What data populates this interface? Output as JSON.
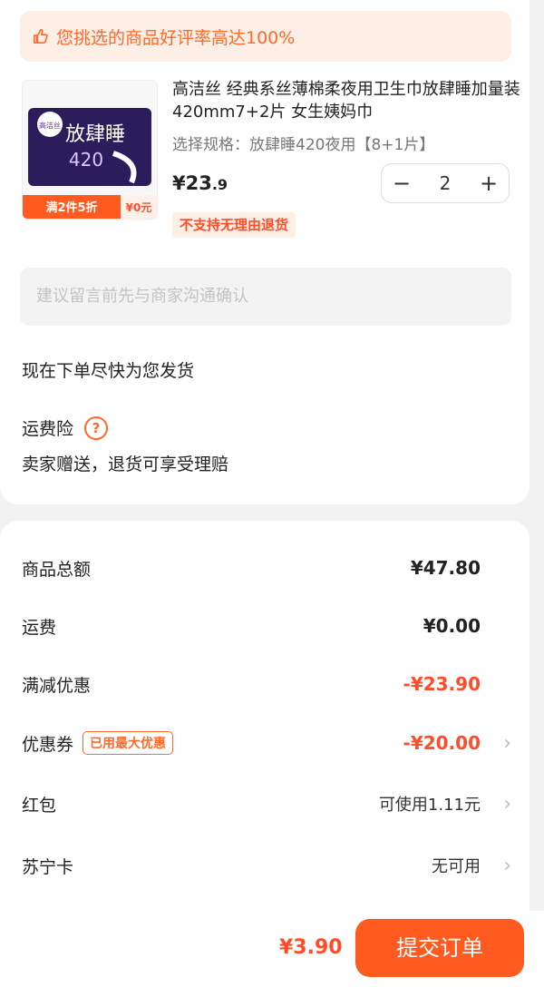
{
  "banner": {
    "text": "您挑选的商品好评率高达100%",
    "icon": "thumbs-up-icon"
  },
  "product": {
    "thumb_brand": "高洁丝",
    "thumb_title": "放肆睡",
    "thumb_size": "420",
    "thumb_promo": "满2件5折",
    "thumb_price": "¥0元",
    "title": "高洁丝 经典系丝薄棉柔夜用卫生巾放肆睡加量装420mm7+2片 女生姨妈巾",
    "spec": "选择规格：放肆睡420夜用【8+1片】",
    "price_main": "¥23",
    "price_dec": ".9",
    "quantity": "2",
    "minus": "−",
    "plus": "+",
    "return_tag": "不支持无理由退货"
  },
  "memo": {
    "placeholder": "建议留言前先与商家沟通确认"
  },
  "shipping_note": "现在下单尽快为您发货",
  "insurance": {
    "label": "运费险",
    "help_icon": "question-circle-icon",
    "desc": "卖家赠送，退货可享受理赔"
  },
  "summary": [
    {
      "label": "商品总额",
      "value": "¥47.80"
    },
    {
      "label": "运费",
      "value": "¥0.00"
    },
    {
      "label": "满减优惠",
      "value": "-¥23.90"
    },
    {
      "label": "优惠券",
      "badge": "已用最大优惠",
      "value": "-¥20.00"
    },
    {
      "label": "红包",
      "value": "可使用1.11元"
    },
    {
      "label": "苏宁卡",
      "value": "无可用"
    }
  ],
  "footer": {
    "total": "¥3.90",
    "submit": "提交订单"
  },
  "colors": {
    "accent": "#ff5a1f",
    "discount": "#ff4d2a",
    "banner_bg": "#fdeee6"
  }
}
